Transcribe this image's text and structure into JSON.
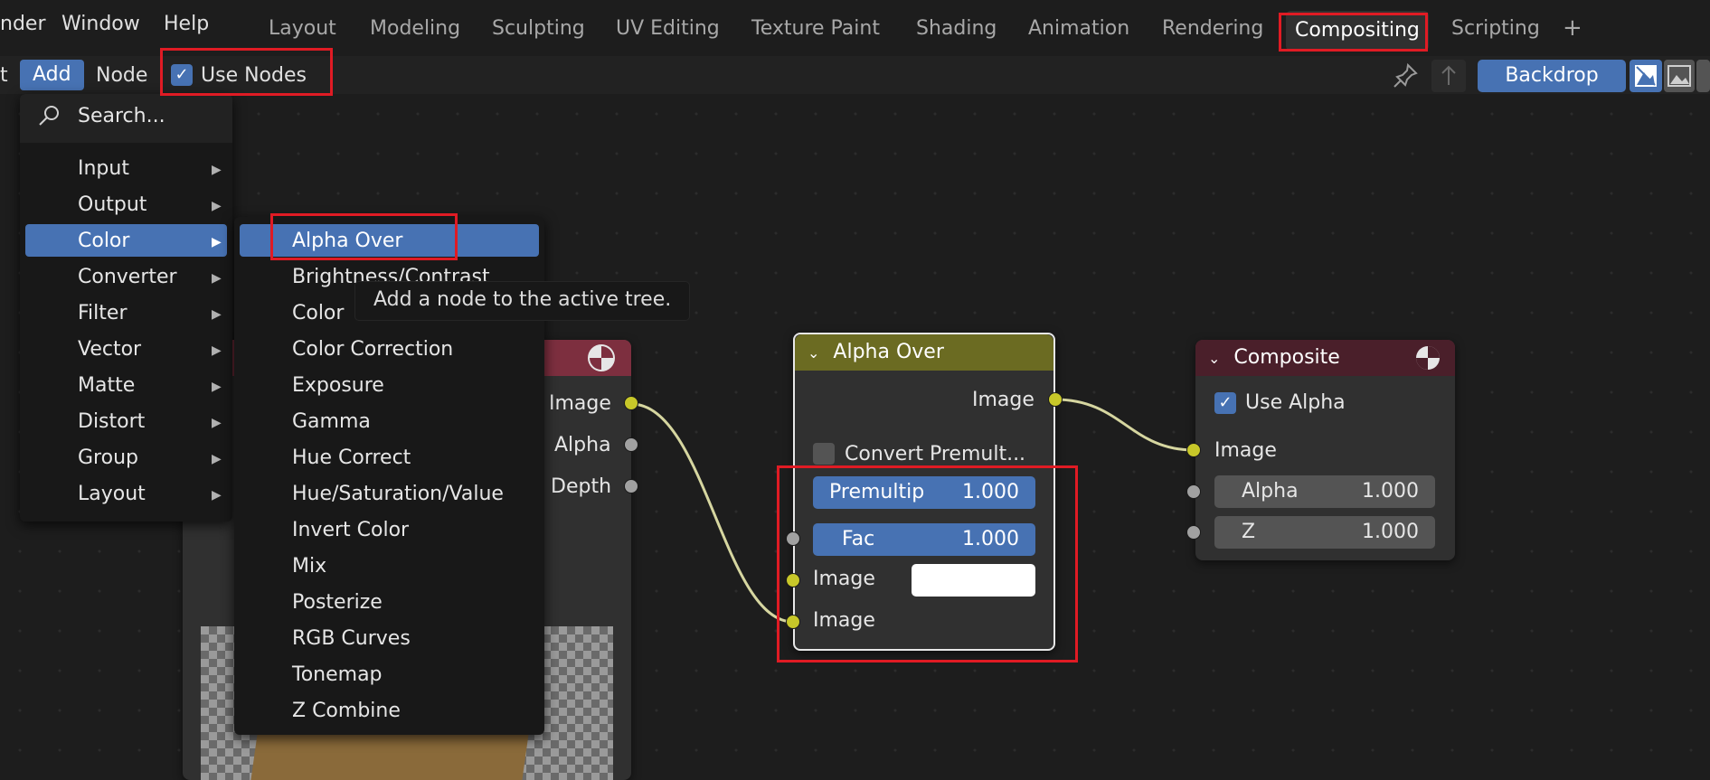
{
  "topbar": {
    "menus": [
      "nder",
      "Window",
      "Help"
    ],
    "workspaces": [
      "Layout",
      "Modeling",
      "Sculpting",
      "UV Editing",
      "Texture Paint",
      "Shading",
      "Animation",
      "Rendering",
      "Compositing",
      "Scripting"
    ],
    "active_workspace": "Compositing",
    "add_workspace": "+"
  },
  "header": {
    "edge_text": "t",
    "add_label": "Add",
    "node_label": "Node",
    "use_nodes_label": "Use Nodes",
    "use_nodes_checked": true,
    "backdrop_label": "Backdrop"
  },
  "add_menu": {
    "search_label": "Search...",
    "items": [
      "Input",
      "Output",
      "Color",
      "Converter",
      "Filter",
      "Vector",
      "Matte",
      "Distort",
      "Group",
      "Layout"
    ],
    "selected": "Color"
  },
  "color_submenu": {
    "items": [
      "Alpha Over",
      "Brightness/Contrast",
      "Color",
      "Color Correction",
      "Exposure",
      "Gamma",
      "Hue Correct",
      "Hue/Saturation/Value",
      "Invert Color",
      "Mix",
      "Posterize",
      "RGB Curves",
      "Tonemap",
      "Z Combine"
    ],
    "selected": "Alpha Over"
  },
  "tooltip": {
    "text": "Add a node to the active tree."
  },
  "render_layers_node": {
    "outputs": [
      "Image",
      "Alpha",
      "Depth"
    ]
  },
  "alpha_over_node": {
    "title": "Alpha Over",
    "output": "Image",
    "convert_label": "Convert Premult...",
    "premul_label": "Premultip",
    "premul_value": "1.000",
    "fac_label": "Fac",
    "fac_value": "1.000",
    "input1": "Image",
    "input2": "Image"
  },
  "composite_node": {
    "title": "Composite",
    "use_alpha_label": "Use Alpha",
    "input_image": "Image",
    "alpha_label": "Alpha",
    "alpha_value": "1.000",
    "z_label": "Z",
    "z_value": "1.000"
  },
  "colors": {
    "accent": "#4772b3",
    "socket_color": "#c7c729",
    "alpha_over_header": "#6b6b22",
    "composite_header": "#4a1f2a",
    "render_layers_header": "#7d2f3f",
    "annotation": "#e01b24"
  }
}
